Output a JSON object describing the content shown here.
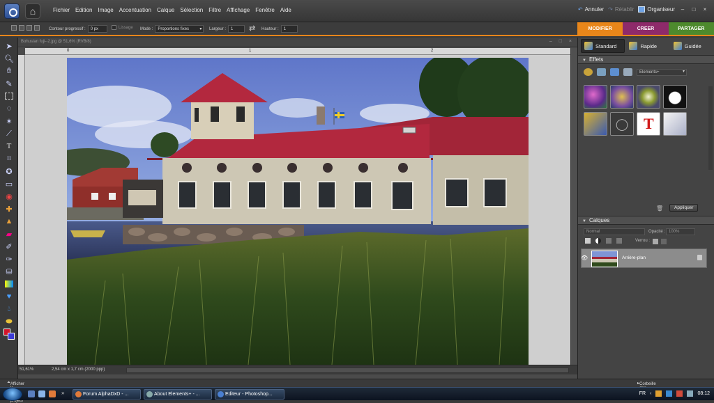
{
  "app": {
    "menu": [
      "Fichier",
      "Edition",
      "Image",
      "Accentuation",
      "Calque",
      "Sélection",
      "Filtre",
      "Affichage",
      "Fenêtre",
      "Aide"
    ],
    "undo_label": "Annuler",
    "redo_label": "Rétablir",
    "organizer_label": "Organiseur",
    "window_controls": [
      "–",
      "□",
      "×"
    ]
  },
  "options_bar": {
    "feather_label": "Contour progressif :",
    "feather_value": "0 px",
    "antialias_label": "Lissage",
    "mode_label": "Mode :",
    "mode_value": "Proportions fixes",
    "width_label": "Largeur :",
    "width_value": "1",
    "height_label": "Hauteur :",
    "height_value": "1"
  },
  "mode_tabs": [
    {
      "label": "MODIFIER",
      "color": "#e8861a"
    },
    {
      "label": "CREER",
      "color": "#8e2a6a"
    },
    {
      "label": "PARTAGER",
      "color": "#4d8a2d"
    }
  ],
  "edit_modes": [
    "Standard",
    "Rapide",
    "Guidée"
  ],
  "document": {
    "title": "Bohuslan fuji--2.jpg @ 51,6% (RVB/8)",
    "ruler_marks": [
      "0",
      "1",
      "2"
    ],
    "zoom": "51,61%",
    "info": "2,54 cm x 1,7 cm (2000 ppp)"
  },
  "effects_panel": {
    "title": "Effets",
    "dropdown": "Elements+",
    "apply_button": "Appliquer"
  },
  "layers_panel": {
    "title": "Calques",
    "blend_mode": "Normal",
    "opacity_label": "Opacité :",
    "opacity_value": "100%",
    "lock_label": "Verrou :",
    "layer_name": "Arrière-plan"
  },
  "bin_bar": {
    "left": "Afficher la corbeille des projets",
    "right": "Corbeille des palettes"
  },
  "taskbar": {
    "buttons": [
      "Forum AlphaDxD - ...",
      "About Elements+ - ...",
      "Editeur - Photoshop..."
    ],
    "lang": "FR",
    "time": "08:12"
  }
}
